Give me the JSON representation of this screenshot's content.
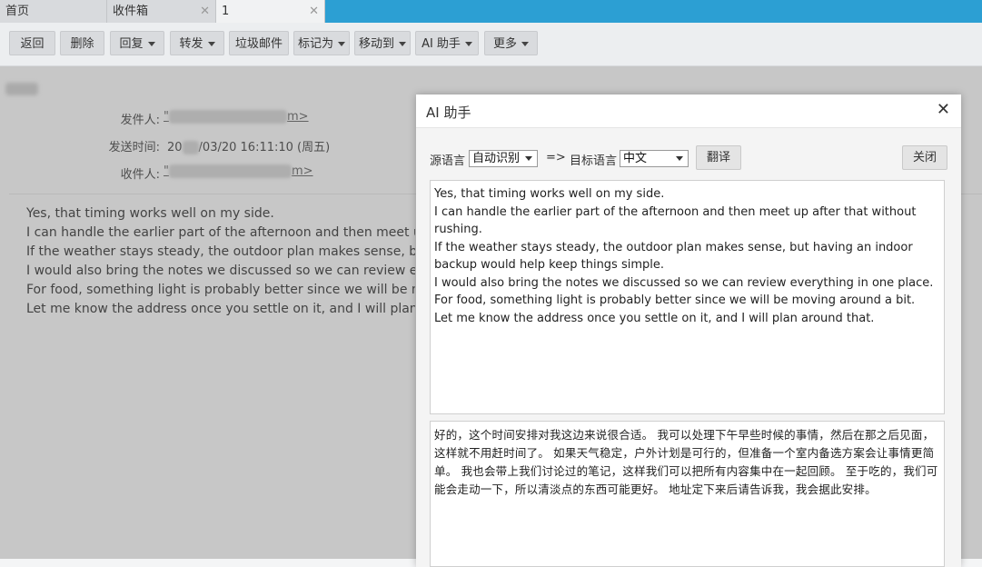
{
  "tabs": [
    {
      "label": "首页",
      "closable": false
    },
    {
      "label": "收件箱",
      "closable": true
    },
    {
      "label": "1",
      "closable": true
    }
  ],
  "toolbar": {
    "back": "返回",
    "delete": "删除",
    "reply": "回复",
    "forward": "转发",
    "spam": "垃圾邮件",
    "mark_as": "标记为",
    "move_to": "移动到",
    "ai_assistant": "AI 助手",
    "more": "更多"
  },
  "mail": {
    "from_label": "发件人:",
    "from_value_start": "\"",
    "from_value_end": "m>",
    "sent_label": "发送时间:",
    "sent_value_prefix": "20",
    "sent_value": "/03/20 16:11:10 (周五)",
    "to_label": "收件人:",
    "to_value_start": "\"",
    "to_value_end": "m>",
    "body": [
      "Yes, that timing works well on my side.",
      "I can handle the earlier part of the afternoon and then meet up a",
      "If the weather stays steady, the outdoor plan makes sense, but h",
      "I would also bring the notes we discussed so we can review ever",
      "For food, something light is probably better since we will be mo",
      "Let me know the address once you settle on it, and I will plan ar"
    ]
  },
  "dialog": {
    "title": "AI 助手",
    "source_lang_label": "源语言",
    "source_lang_value": "自动识别",
    "arrow": "=>",
    "target_lang_label": "目标语言",
    "target_lang_value": "中文",
    "translate_button": "翻译",
    "close_button": "关闭",
    "source_text": [
      "Yes, that timing works well on my side.",
      "I can handle the earlier part of the afternoon and then meet up after that without rushing.",
      "If the weather stays steady, the outdoor plan makes sense, but having an indoor backup would help keep things simple.",
      "I would also bring the notes we discussed so we can review everything in one place.",
      "For food, something light is probably better since we will be moving around a bit.",
      "Let me know the address once you settle on it, and I will plan around that."
    ],
    "translated_text": "好的，这个时间安排对我这边来说很合适。 我可以处理下午早些时候的事情，然后在那之后见面，这样就不用赶时间了。 如果天气稳定，户外计划是可行的，但准备一个室内备选方案会让事情更简单。 我也会带上我们讨论过的笔记，这样我们可以把所有内容集中在一起回顾。 至于吃的，我们可能会走动一下，所以清淡点的东西可能更好。 地址定下来后请告诉我，我会据此安排。"
  },
  "colors": {
    "tabbar_accent": "#2c9fd3",
    "toolbar_bg": "#eceef0",
    "dialog_bg": "#f4f4f4"
  }
}
